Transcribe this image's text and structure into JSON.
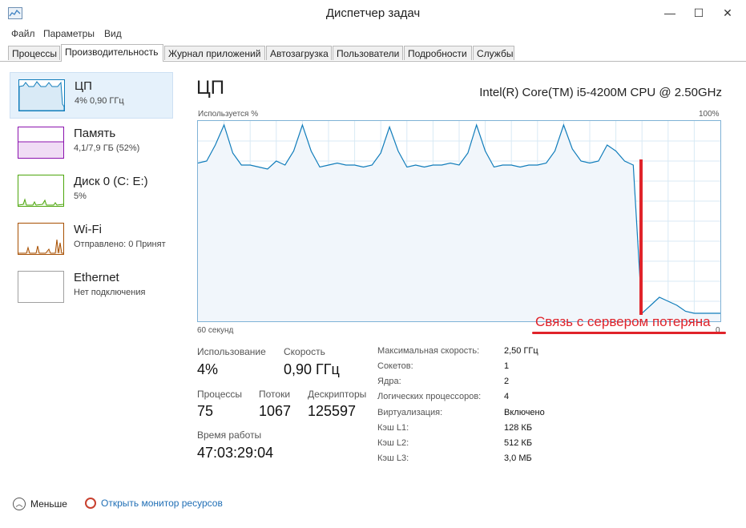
{
  "window": {
    "title": "Диспетчер задач",
    "minimize_glyph": "—",
    "maximize_glyph": "☐",
    "close_glyph": "✕"
  },
  "menu": [
    "Файл",
    "Параметры",
    "Вид"
  ],
  "tabs": [
    "Процессы",
    "Производительность",
    "Журнал приложений",
    "Автозагрузка",
    "Пользователи",
    "Подробности",
    "Службы"
  ],
  "active_tab": "Производительность",
  "resources": [
    {
      "name": "ЦП",
      "sub": "4% 0,90 ГГц",
      "color": "#117dbb"
    },
    {
      "name": "Память",
      "sub": "4,1/7,9 ГБ (52%)",
      "color": "#8b12ae"
    },
    {
      "name": "Диск 0 (C: E:)",
      "sub": "5%",
      "color": "#4da60c"
    },
    {
      "name": "Wi-Fi",
      "sub": "Отправлено: 0 Принят",
      "color": "#a74f01"
    },
    {
      "name": "Ethernet",
      "sub": "Нет подключения",
      "color": "#a0a0a0"
    }
  ],
  "cpu": {
    "title": "ЦП",
    "model": "Intel(R) Core(TM) i5-4200M CPU @ 2.50GHz",
    "graph_label": "Используется %",
    "graph_max": "100%",
    "graph_time": "60 секунд",
    "graph_min": "0"
  },
  "stats": {
    "utilization": {
      "label": "Использование",
      "value": "4%"
    },
    "speed": {
      "label": "Скорость",
      "value": "0,90 ГГц"
    },
    "processes": {
      "label": "Процессы",
      "value": "75"
    },
    "threads": {
      "label": "Потоки",
      "value": "1067"
    },
    "handles": {
      "label": "Дескрипторы",
      "value": "125597"
    },
    "uptime": {
      "label": "Время работы",
      "value": "47:03:29:04"
    }
  },
  "info": [
    {
      "k": "Максимальная скорость:",
      "v": "2,50 ГГц"
    },
    {
      "k": "Сокетов:",
      "v": "1"
    },
    {
      "k": "Ядра:",
      "v": "2"
    },
    {
      "k": "Логических процессоров:",
      "v": "4"
    },
    {
      "k": "Виртуализация:",
      "v": "Включено"
    },
    {
      "k": "Кэш L1:",
      "v": "128 КБ"
    },
    {
      "k": "Кэш L2:",
      "v": "512 КБ"
    },
    {
      "k": "Кэш L3:",
      "v": "3,0 МБ"
    }
  ],
  "footer": {
    "less": "Меньше",
    "monitor": "Открыть монитор ресурсов"
  },
  "annotation": {
    "text": "Связь с сервером потеряна",
    "color": "#e0232a"
  },
  "chart_data": {
    "type": "area",
    "title": "",
    "ylabel": "Используется %",
    "ylim": [
      0,
      100
    ],
    "xlim": [
      60,
      0
    ],
    "x": [
      60,
      59,
      58,
      57,
      56,
      55,
      54,
      53,
      52,
      51,
      50,
      49,
      48,
      47,
      46,
      45,
      44,
      43,
      42,
      41,
      40,
      39,
      38,
      37,
      36,
      35,
      34,
      33,
      32,
      31,
      30,
      29,
      28,
      27,
      26,
      25,
      24,
      23,
      22,
      21,
      20,
      19,
      18,
      17,
      16,
      15,
      14,
      13,
      12,
      11,
      10,
      9,
      8,
      7,
      6,
      5,
      4,
      3,
      2,
      1,
      0
    ],
    "values": [
      79,
      80,
      88,
      98,
      84,
      78,
      78,
      77,
      76,
      80,
      78,
      85,
      98,
      85,
      77,
      78,
      79,
      78,
      78,
      77,
      78,
      84,
      97,
      85,
      77,
      78,
      77,
      78,
      78,
      79,
      78,
      84,
      98,
      85,
      77,
      78,
      78,
      77,
      78,
      78,
      79,
      85,
      98,
      86,
      80,
      79,
      80,
      88,
      85,
      80,
      78,
      4,
      8,
      12,
      10,
      8,
      5,
      4,
      4,
      4,
      4
    ]
  }
}
